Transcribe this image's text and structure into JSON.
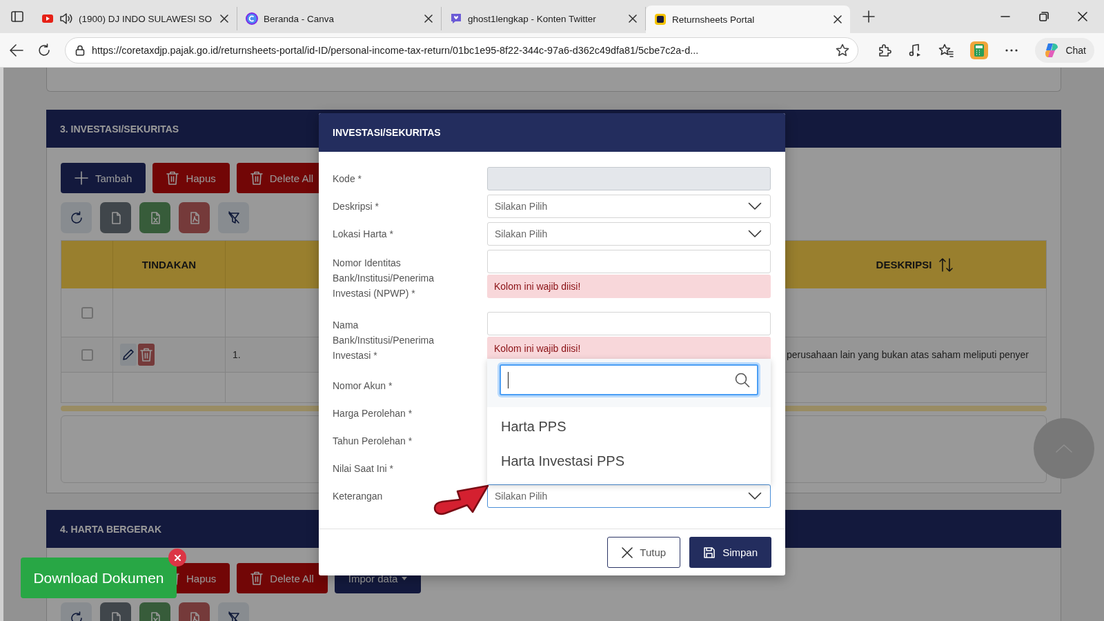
{
  "browser": {
    "tabs": [
      {
        "kind": "video",
        "title": "(1900) DJ INDO SULAWESI SO",
        "audio": true,
        "selected": false
      },
      {
        "kind": "design",
        "title": "Beranda - Canva",
        "audio": false,
        "selected": false
      },
      {
        "kind": "chat",
        "title": "ghost1lengkap - Konten Twitter",
        "audio": false,
        "selected": false
      },
      {
        "kind": "portal",
        "title": "Returnsheets Portal",
        "audio": false,
        "selected": true
      }
    ],
    "url": "https://coretaxdjp.pajak.go.id/returnsheets-portal/id-ID/personal-income-tax-return/01bc1e95-8f22-344c-97a6-d362c49dfa81/5cbe7c2a-d...",
    "chat_label": "Chat"
  },
  "sections": [
    {
      "title": "3. INVESTASI/SEKURITAS",
      "buttons": [
        {
          "kind": "add",
          "label": "Tambah"
        },
        {
          "kind": "delete",
          "label": "Hapus"
        },
        {
          "kind": "delete",
          "label": "Delete All"
        }
      ],
      "table": {
        "columns": [
          "TINDAKAN",
          "DESKRIPSI"
        ],
        "rows": [
          {
            "kind": "select-all",
            "checked": false
          },
          {
            "kind": "record",
            "checked": false,
            "number": "1.",
            "description": "perusahaan lain yang bukan atas saham meliputi penyer"
          }
        ]
      }
    },
    {
      "title": "4. HARTA BERGERAK",
      "buttons": [
        {
          "kind": "delete",
          "label": "Hapus"
        },
        {
          "kind": "delete",
          "label": "Delete All"
        },
        {
          "kind": "import",
          "label": "Impor data"
        }
      ]
    }
  ],
  "modal": {
    "title": "INVESTASI/SEKURITAS",
    "fields": [
      {
        "label": "Kode *",
        "kind": "text",
        "disabled": true
      },
      {
        "label": "Deskripsi *",
        "kind": "select",
        "placeholder": "Silakan Pilih",
        "open": false
      },
      {
        "label": "Lokasi Harta *",
        "kind": "select",
        "placeholder": "Silakan Pilih",
        "open": false
      },
      {
        "label": "Nomor Identitas Bank/Institusi/Penerima Investasi (NPWP) *",
        "kind": "text",
        "disabled": false,
        "error": "Kolom ini wajib diisi!"
      },
      {
        "label": "Nama Bank/Institusi/Penerima Investasi *",
        "kind": "text",
        "disabled": false,
        "error": "Kolom ini wajib diisi!"
      },
      {
        "label": "Nomor Akun *"
      },
      {
        "label": "Harga Perolehan *"
      },
      {
        "label": "Tahun Perolehan *"
      },
      {
        "label": "Nilai Saat Ini *"
      },
      {
        "label": "Keterangan",
        "kind": "select",
        "placeholder": "Silakan Pilih",
        "open": true,
        "options": [
          {
            "label": "Harta PPS",
            "selected": false
          },
          {
            "label": "Harta Investasi PPS",
            "selected": false
          }
        ]
      }
    ],
    "buttons": [
      {
        "kind": "cancel",
        "label": "Tutup"
      },
      {
        "kind": "save",
        "label": "Simpan"
      }
    ]
  },
  "download_button": {
    "label": "Download Dokumen"
  }
}
